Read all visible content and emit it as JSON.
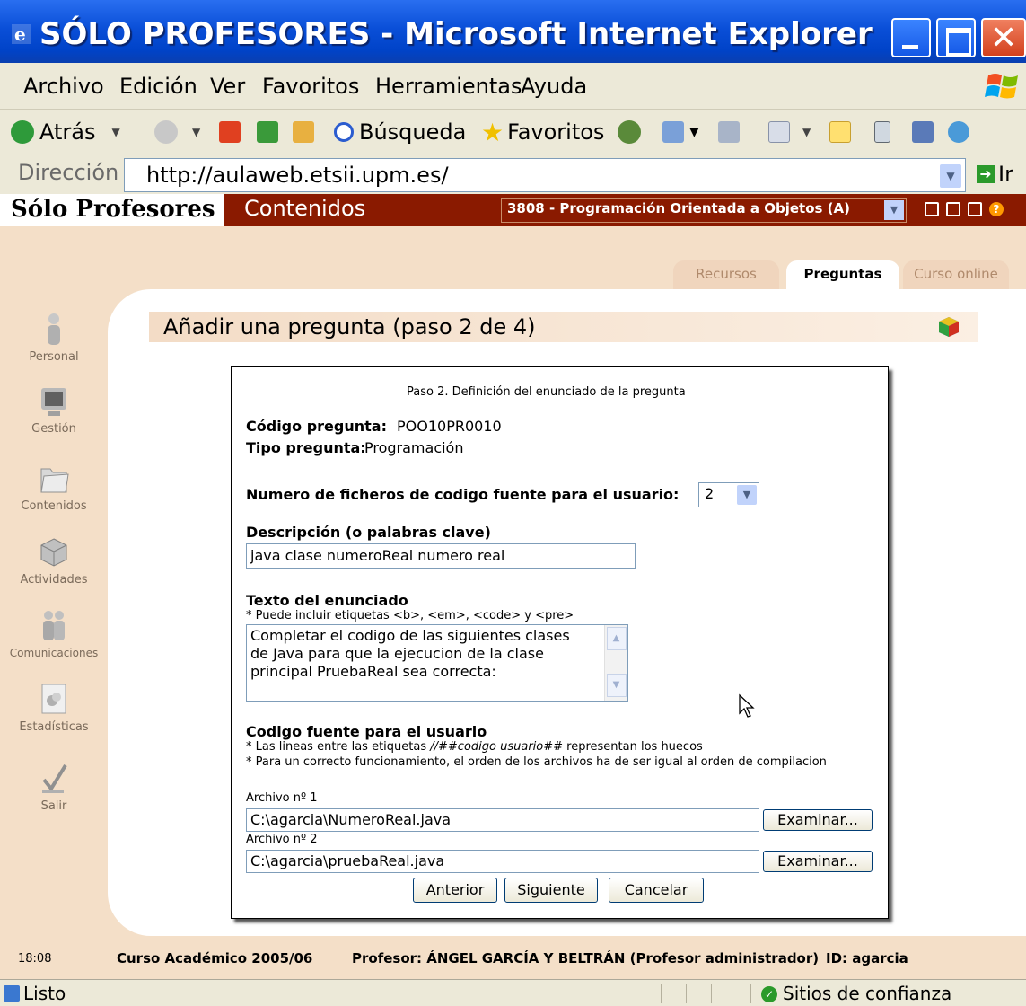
{
  "window": {
    "title": "SÓLO PROFESORES - Microsoft Internet Explorer"
  },
  "menu": [
    "Archivo",
    "Edición",
    "Ver",
    "Favoritos",
    "Herramientas",
    "Ayuda"
  ],
  "toolbar": {
    "back": "Atrás",
    "search": "Búsqueda",
    "favorites": "Favoritos"
  },
  "address": {
    "label": "Dirección",
    "url": "http://aulaweb.etsii.upm.es/",
    "go": "Ir"
  },
  "header": {
    "brand": "Sólo Profesores",
    "section": "Contenidos",
    "course": "3808 - Programación Orientada a Objetos (A)"
  },
  "tabs": {
    "recursos": "Recursos",
    "preguntas": "Preguntas",
    "curso": "Curso online"
  },
  "sidebar": [
    "Personal",
    "Gestión",
    "Contenidos",
    "Actividades",
    "Comunicaciones",
    "Estadísticas",
    "Salir"
  ],
  "page": {
    "title": "Añadir una pregunta (paso 2 de 4)"
  },
  "form": {
    "step": "Paso 2. Definición del enunciado de la pregunta",
    "code_label": "Código pregunta:",
    "code_value": "POO10PR0010",
    "type_label": "Tipo pregunta:",
    "type_value": "Programación",
    "numfiles_label": "Numero de ficheros de codigo fuente para el usuario:",
    "numfiles_value": "2",
    "desc_label": "Descripción (o palabras clave)",
    "desc_value": "java clase numeroReal numero real",
    "text_label": "Texto del enunciado",
    "text_hint": "* Puede incluir etiquetas <b>, <em>, <code> y <pre>",
    "text_line1": "Completar el codigo de las siguientes clases",
    "text_line2": "de Java para que la ejecucion de la clase",
    "text_line3": "principal PruebaReal sea correcta:",
    "src_label": "Codigo fuente para el usuario",
    "src_hint1_a": "* Las lineas entre las etiquetas ",
    "src_hint1_tag": "//##codigo usuario##",
    "src_hint1_b": " representan los huecos",
    "src_hint2": "* Para un correcto funcionamiento, el orden de los archivos ha de ser igual al orden de compilacion",
    "file1_label": "Archivo nº 1",
    "file1_value": "C:\\agarcia\\NumeroReal.java",
    "file2_label": "Archivo nº 2",
    "file2_value": "C:\\agarcia\\pruebaReal.java",
    "browse": "Examinar...",
    "prev": "Anterior",
    "next": "Siguiente",
    "cancel": "Cancelar"
  },
  "footer": {
    "time": "18:08",
    "year": "Curso Académico 2005/06",
    "teacher": "Profesor: ÁNGEL GARCÍA Y BELTRÁN (Profesor administrador)",
    "id": "ID: agarcia"
  },
  "status": {
    "left": "Listo",
    "right": "Sitios de confianza"
  },
  "colors": {
    "header_bg": "#8a1a00",
    "page_bg": "#f4dfc8",
    "titlebar": "#0a4fd8"
  }
}
